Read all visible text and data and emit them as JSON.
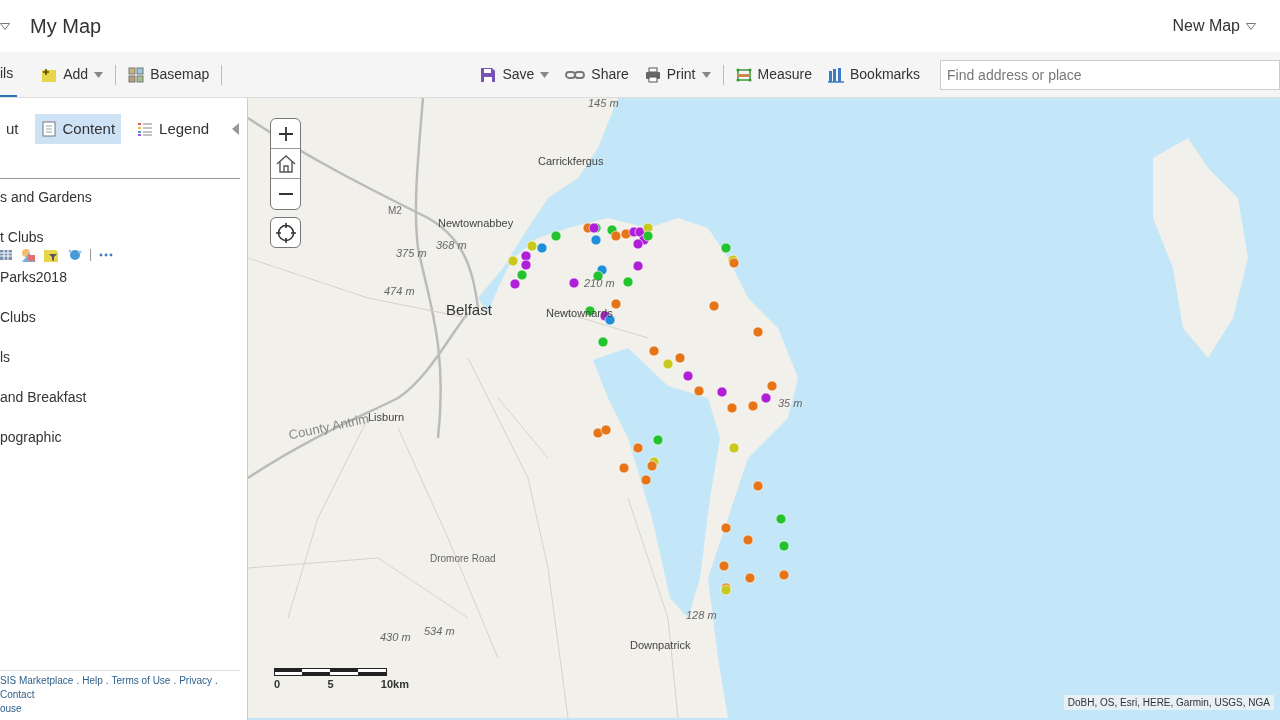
{
  "header": {
    "title": "My Map",
    "account": "New Map"
  },
  "toolbar": {
    "tab": {
      "label": "ils",
      "selected": true
    },
    "left_buttons": [
      {
        "label": "Add",
        "kind": "add",
        "dropdown": true
      },
      {
        "label": "Basemap",
        "kind": "basemap",
        "dropdown": false
      }
    ],
    "right_buttons": [
      {
        "label": "Save",
        "kind": "save",
        "dropdown": true
      },
      {
        "label": "Share",
        "kind": "share",
        "dropdown": false
      },
      {
        "label": "Print",
        "kind": "print",
        "dropdown": true
      },
      {
        "label": "Measure",
        "kind": "measure",
        "dropdown": false
      },
      {
        "label": "Bookmarks",
        "kind": "bookmarks",
        "dropdown": false
      }
    ],
    "search": {
      "placeholder": "Find address or place"
    }
  },
  "panel": {
    "tabs": [
      {
        "label": "ut",
        "kind": "about",
        "selected": false
      },
      {
        "label": "Content",
        "kind": "content",
        "selected": true
      },
      {
        "label": "Legend",
        "kind": "legend",
        "selected": false
      }
    ],
    "layers": [
      {
        "name": "s and Gardens",
        "expanded": false
      },
      {
        "name": "t Clubs",
        "expanded": true
      },
      {
        "name": "Parks2018",
        "expanded": false
      },
      {
        "name": "Clubs",
        "expanded": false
      },
      {
        "name": "ls",
        "expanded": false
      },
      {
        "name": "and Breakfast",
        "expanded": false
      },
      {
        "name": "pographic",
        "expanded": false
      }
    ],
    "footer_links": [
      "SIS Marketplace",
      "Help",
      "Terms of Use",
      "Privacy",
      "Contact",
      "ouse"
    ],
    "footer_separator": "."
  },
  "map": {
    "places": [
      {
        "label": "145 m",
        "kind": "elevation"
      },
      {
        "label": "Carrickfergus",
        "kind": "town"
      },
      {
        "label": "M2",
        "kind": "road"
      },
      {
        "label": "Newtownabbey",
        "kind": "town"
      },
      {
        "label": "375 m",
        "kind": "elevation"
      },
      {
        "label": "368 m",
        "kind": "elevation"
      },
      {
        "label": "474 m",
        "kind": "elevation"
      },
      {
        "label": "210 m",
        "kind": "elevation"
      },
      {
        "label": "Belfast",
        "kind": "city"
      },
      {
        "label": "Newtownards",
        "kind": "town"
      },
      {
        "label": "35 m",
        "kind": "elevation"
      },
      {
        "label": "Lisburn",
        "kind": "town"
      },
      {
        "label": "County Antrim",
        "kind": "region"
      },
      {
        "label": "Dromore Road",
        "kind": "road"
      },
      {
        "label": "430 m",
        "kind": "elevation"
      },
      {
        "label": "534 m",
        "kind": "elevation"
      },
      {
        "label": "128 m",
        "kind": "elevation"
      },
      {
        "label": "Downpatrick",
        "kind": "town"
      }
    ],
    "scale_labels": [
      "0",
      "5",
      "10km"
    ],
    "attribution": "DoBH, OS, Esri, HERE, Garmin, USGS, NGA"
  }
}
